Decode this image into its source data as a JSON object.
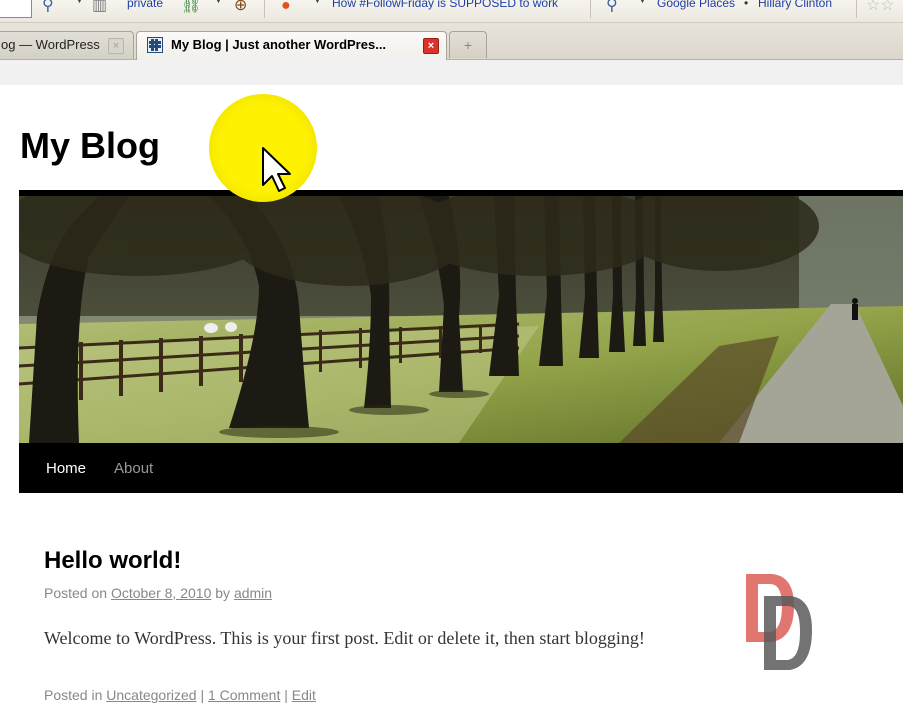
{
  "toolbar": {
    "bookmark_private": "private",
    "bookmark_followfriday": "How #FollowFriday is SUPPOSED to work",
    "bookmark_google_places": "Google Places",
    "bookmark_bullet": "•",
    "bookmark_hillary": "Hillary Clinton",
    "icons": [
      "search-icon",
      "bookmarks-icon",
      "link-icon",
      "compass-icon",
      "fire-icon",
      "magnifier-icon",
      "star-icon"
    ]
  },
  "tabs": [
    {
      "label": "og — WordPress",
      "active": false
    },
    {
      "label": "My Blog | Just another WordPres...",
      "active": true
    }
  ],
  "new_tab_symbol": "+",
  "site": {
    "title": "My Blog"
  },
  "nav": {
    "items": [
      "Home",
      "About"
    ]
  },
  "post": {
    "title": "Hello world!",
    "posted_on": "Posted on",
    "date": "October 8, 2010",
    "by": "by",
    "author": "admin",
    "content": "Welcome to WordPress. This is your first post. Edit or delete it, then start blogging!",
    "posted_in": "Posted in",
    "category": "Uncategorized",
    "separator": "|",
    "comments": "1 Comment",
    "edit": "Edit"
  },
  "colors": {
    "nav_bg": "#000000",
    "nav_active": "#ffffff",
    "nav_inactive": "#999999",
    "meta_text": "#888888",
    "highlight": "#fff200"
  }
}
